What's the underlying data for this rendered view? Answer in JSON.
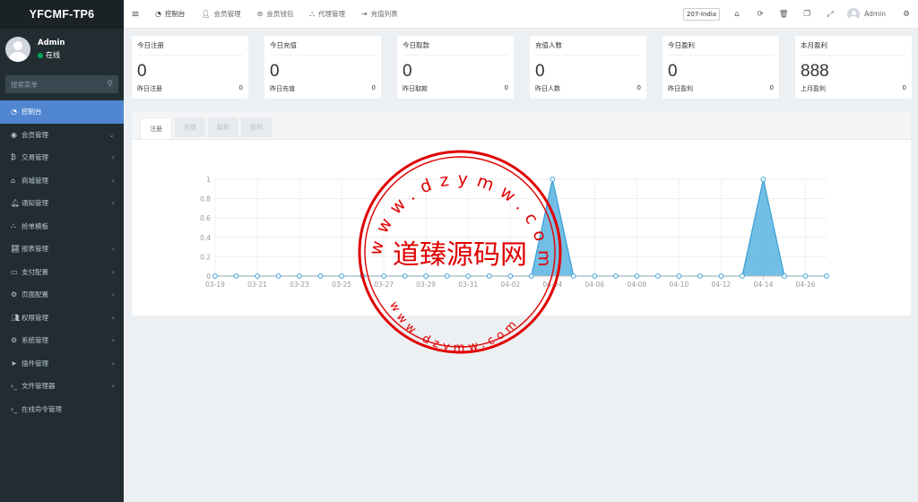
{
  "brand": "YFCMF-TP6",
  "user": {
    "name": "Admin",
    "status": "在线"
  },
  "sidebar": {
    "search_placeholder": "搜索菜单",
    "items": [
      {
        "label": "控制台",
        "icon": "dashboard-icon",
        "active": true,
        "arrow": ""
      },
      {
        "label": "会员管理",
        "icon": "user-circle-icon",
        "arrow": "⌄"
      },
      {
        "label": "交易管理",
        "icon": "bitcoin-icon",
        "arrow": "‹"
      },
      {
        "label": "商城管理",
        "icon": "home-icon",
        "arrow": "‹"
      },
      {
        "label": "通知管理",
        "icon": "bell-icon",
        "arrow": "‹"
      },
      {
        "label": "抢单模板",
        "icon": "sitemap-icon",
        "arrow": ""
      },
      {
        "label": "报表管理",
        "icon": "line-chart-icon",
        "arrow": "‹"
      },
      {
        "label": "支付配置",
        "icon": "credit-card-icon",
        "arrow": "‹"
      },
      {
        "label": "页面配置",
        "icon": "gear-icon",
        "arrow": "‹"
      },
      {
        "label": "权限管理",
        "icon": "users-icon",
        "arrow": "‹"
      },
      {
        "label": "系统管理",
        "icon": "gears-icon",
        "arrow": "‹"
      },
      {
        "label": "插件管理",
        "icon": "rocket-icon",
        "arrow": "‹"
      },
      {
        "label": "文件管理器",
        "icon": "terminal-icon",
        "arrow": "‹"
      },
      {
        "label": "在线命令管理",
        "icon": "terminal-icon",
        "arrow": ""
      }
    ]
  },
  "topbar": {
    "tabs": [
      {
        "label": "控制台",
        "icon": "dashboard-icon"
      },
      {
        "label": "会员管理",
        "icon": "user-icon"
      },
      {
        "label": "会员钱包",
        "icon": "wallet-icon"
      },
      {
        "label": "代理管理",
        "icon": "sitemap-icon"
      },
      {
        "label": "充值列表",
        "icon": "sign-in-icon"
      }
    ],
    "lang": "207-India",
    "username": "Admin"
  },
  "cards": [
    {
      "title": "今日注册",
      "value": "0",
      "foot_label": "昨日注册",
      "foot_value": "0"
    },
    {
      "title": "今日充值",
      "value": "0",
      "foot_label": "昨日充值",
      "foot_value": "0"
    },
    {
      "title": "今日取款",
      "value": "0",
      "foot_label": "昨日取款",
      "foot_value": "0"
    },
    {
      "title": "充值人数",
      "value": "0",
      "foot_label": "昨日人数",
      "foot_value": "0"
    },
    {
      "title": "今日盈利",
      "value": "0",
      "foot_label": "昨日盈利",
      "foot_value": "0"
    },
    {
      "title": "本月盈利",
      "value": "888",
      "foot_label": "上月盈利",
      "foot_value": "0"
    }
  ],
  "panel": {
    "tabs": [
      "注册",
      "充值",
      "取款",
      "盈利"
    ],
    "active_tab": 0
  },
  "watermark": {
    "center_text": "道臻源码网",
    "top_text": "www.dzymw.com",
    "bottom_text": "www.dzymw.com",
    "color": "#e00000"
  },
  "chart_data": {
    "type": "area",
    "x": [
      "03-19",
      "03-20",
      "03-21",
      "03-22",
      "03-23",
      "03-24",
      "03-25",
      "03-26",
      "03-27",
      "03-28",
      "03-29",
      "03-30",
      "03-31",
      "04-01",
      "04-02",
      "04-03",
      "04-04",
      "04-05",
      "04-06",
      "04-07",
      "04-08",
      "04-09",
      "04-10",
      "04-11",
      "04-12",
      "04-13",
      "04-14",
      "04-15",
      "04-16",
      "04-17"
    ],
    "tick_labels": [
      "03-19",
      "03-21",
      "03-23",
      "03-25",
      "03-27",
      "03-29",
      "03-31",
      "04-02",
      "04-04",
      "04-06",
      "04-08",
      "04-10",
      "04-12",
      "04-14",
      "04-16"
    ],
    "values": [
      0,
      0,
      0,
      0,
      0,
      0,
      0,
      0,
      0,
      0,
      0,
      0,
      0,
      0,
      0,
      0,
      1,
      0,
      0,
      0,
      0,
      0,
      0,
      0,
      0,
      0,
      1,
      0,
      0,
      0
    ],
    "ylim": [
      0,
      1
    ],
    "yticks": [
      "0",
      "0.2",
      "0.4",
      "0.6",
      "0.8",
      "1"
    ],
    "grid": true,
    "colors": {
      "fill": "#5ab3e0",
      "line": "#3ea2d6"
    }
  }
}
